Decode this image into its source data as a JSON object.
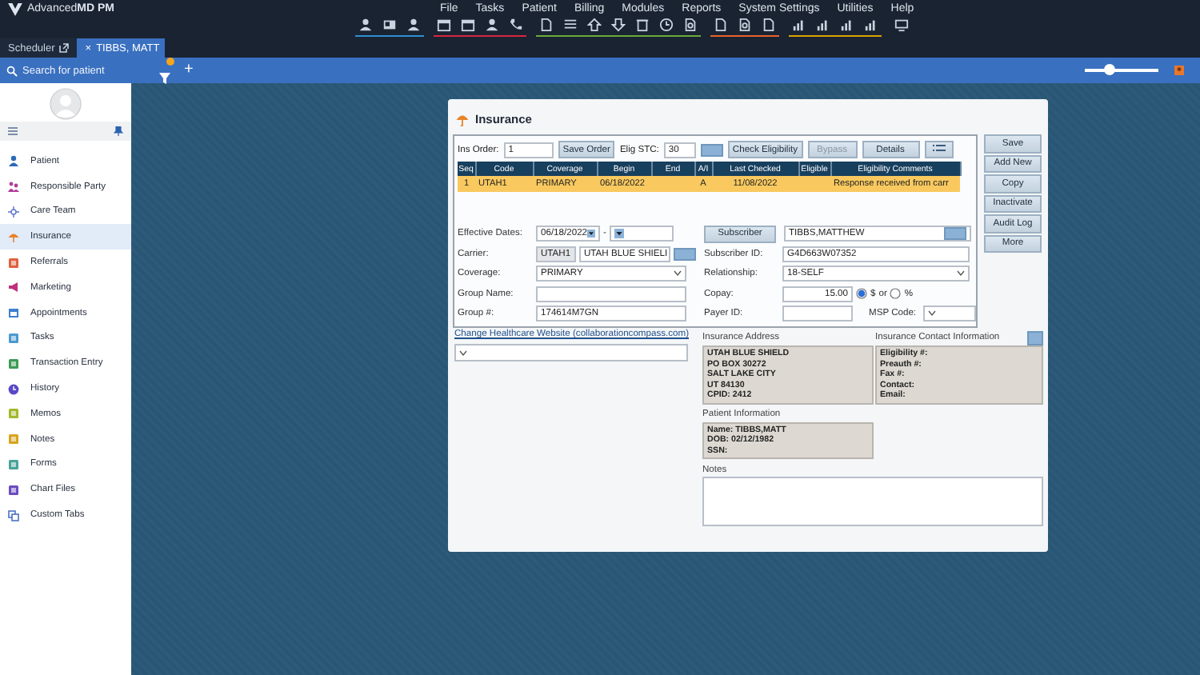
{
  "app": {
    "logo": "Advanced**MD PM**"
  },
  "menu": [
    "File",
    "Tasks",
    "Patient",
    "Billing",
    "Modules",
    "Reports",
    "System Settings",
    "Utilities",
    "Help"
  ],
  "toolbar_groups": [
    {
      "color": "#2f8fd0"
    },
    {
      "color": "#d8263f"
    },
    {
      "color": "#6aab3c"
    },
    {
      "color": "#e8622a"
    },
    {
      "color": "#d9a400"
    }
  ],
  "tabs": [
    {
      "label": "Scheduler",
      "selected": false
    },
    {
      "label": "TIBBS, MATT",
      "selected": true,
      "close": "×"
    }
  ],
  "search": {
    "placeholder": "Search for patient"
  },
  "add": "+",
  "zoom": {
    "level": 0.33
  },
  "sidebar": {
    "items": [
      {
        "label": "Patient",
        "selected": false
      },
      {
        "label": "Responsible Party",
        "selected": false
      },
      {
        "label": "Care Team",
        "selected": false
      },
      {
        "label": "Insurance",
        "selected": true
      },
      {
        "label": "Referrals",
        "selected": false
      },
      {
        "label": "Marketing",
        "selected": false
      },
      {
        "label": "Appointments",
        "selected": false
      },
      {
        "label": "Tasks",
        "selected": false
      },
      {
        "label": "Transaction Entry",
        "selected": false
      },
      {
        "label": "History",
        "selected": false
      },
      {
        "label": "Memos",
        "selected": false
      },
      {
        "label": "Notes",
        "selected": false
      },
      {
        "label": "Forms",
        "selected": false
      },
      {
        "label": "Chart Files",
        "selected": false
      },
      {
        "label": "Custom Tabs",
        "selected": false
      }
    ]
  },
  "dialog": {
    "title": "Insurance",
    "toolbar": {
      "ins_order_label": "Ins Order:",
      "ins_order": "1",
      "save_order": "Save Order",
      "elig_stc_label": "Elig STC:",
      "elig_stc": "30",
      "check_eligibility": "Check Eligibility",
      "bypass": {
        "label": "Bypass",
        "disabled": true
      },
      "details": "Details"
    },
    "table": {
      "columns": [
        "Seq",
        "Code",
        "Coverage",
        "Begin",
        "End",
        "A/I",
        "Last Checked",
        "Eligible",
        "Eligibility Comments"
      ],
      "rows": [
        {
          "selected": true,
          "cells": [
            "1",
            "UTAH1",
            "PRIMARY",
            "06/18/2022",
            null,
            "A",
            "11/08/2022",
            null,
            "Response received from carr"
          ]
        }
      ]
    },
    "form": {
      "effective_dates_label": "Effective Dates:",
      "effective_from": "06/18/2022",
      "date_separator": "-",
      "carrier_label": "Carrier:",
      "carrier_code": "UTAH1",
      "carrier_name": "UTAH BLUE SHIELI",
      "coverage_label": "Coverage:",
      "coverage": "PRIMARY",
      "group_name_label": "Group Name:",
      "group_number_label": "Group #:",
      "group_number": "174614M7GN",
      "subscriber_button": "Subscriber",
      "subscriber": "TIBBS,MATTHEW",
      "subscriber_id_label": "Subscriber ID:",
      "subscriber_id": "G4D663W07352",
      "relationship_label": "Relationship:",
      "relationship": "18-SELF",
      "copay_label": "Copay:",
      "copay": "15.00",
      "copay_units": [
        {
          "label": "$",
          "selected": true
        },
        {
          "label": "%",
          "selected": false
        }
      ],
      "or": "or",
      "payer_id_label": "Payer ID:",
      "msp_code_label": "MSP Code:"
    },
    "side_buttons": [
      "Save",
      "Add New",
      "Copy",
      "Inactivate",
      "Audit Log",
      "More"
    ],
    "website_link": "Change Healthcare Website (collaborationcompass.com)",
    "insurance_address": {
      "label": "Insurance Address",
      "lines": [
        "UTAH BLUE SHIELD",
        "PO BOX 30272",
        "SALT LAKE CITY",
        "UT 84130",
        "CPID: 2412"
      ]
    },
    "contact_info": {
      "label": "Insurance Contact Information",
      "lines": [
        "Eligibility #:",
        "Preauth #:",
        "Fax #:",
        "Contact:",
        "Email:"
      ]
    },
    "patient_info": {
      "label": "Patient Information",
      "lines": [
        "Name: TIBBS,MATT",
        "DOB: 02/12/1982",
        "SSN:"
      ]
    },
    "notes": {
      "label": "Notes"
    }
  }
}
